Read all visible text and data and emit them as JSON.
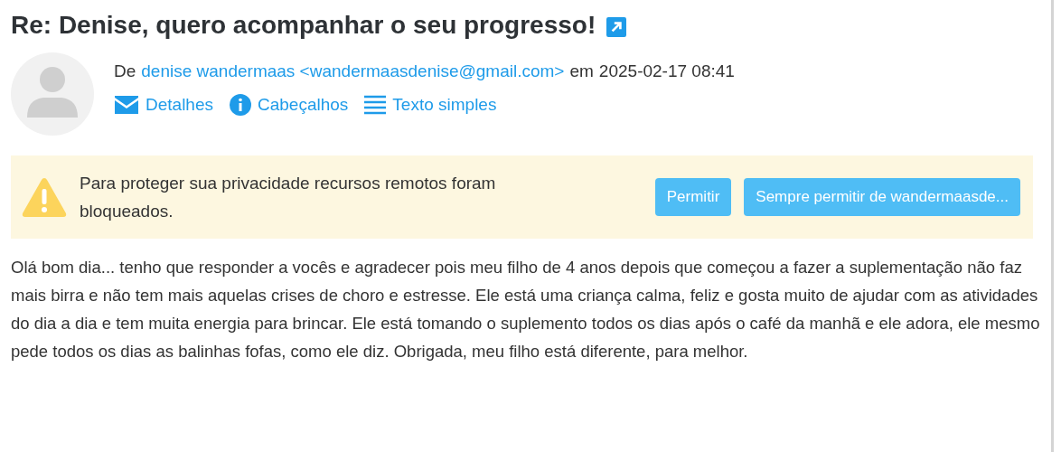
{
  "message": {
    "subject": "Re: Denise, quero acompanhar o seu progresso!",
    "from_label": "De",
    "sender_name": "denise wandermaas",
    "sender_email": "<wandermaasdenise@gmail.com>",
    "date_label": "em",
    "date": "2025-02-17 08:41",
    "actions": [
      {
        "kind": "mail",
        "label": "Detalhes"
      },
      {
        "kind": "info",
        "label": "Cabeçalhos"
      },
      {
        "kind": "lines",
        "label": "Texto simples"
      }
    ]
  },
  "remote_warning": {
    "text": "Para proteger sua privacidade recursos remotos foram bloqueados.",
    "buttons": [
      "Permitir",
      "Sempre permitir de wandermaasde..."
    ]
  },
  "body": "Olá bom dia... tenho que responder a vocês e agradecer pois meu filho de 4 anos depois que começou a fazer a suplementação não faz mais birra e não tem mais aquelas crises de choro e estresse. Ele está uma criança calma, feliz e gosta muito de ajudar com as atividades do dia a dia e tem muita energia para brincar. Ele está tomando o suplemento todos os dias após o café da manhã e ele adora, ele mesmo pede todos os dias as balinhas fofas, como ele diz. Obrigada, meu filho está diferente, para melhor."
}
